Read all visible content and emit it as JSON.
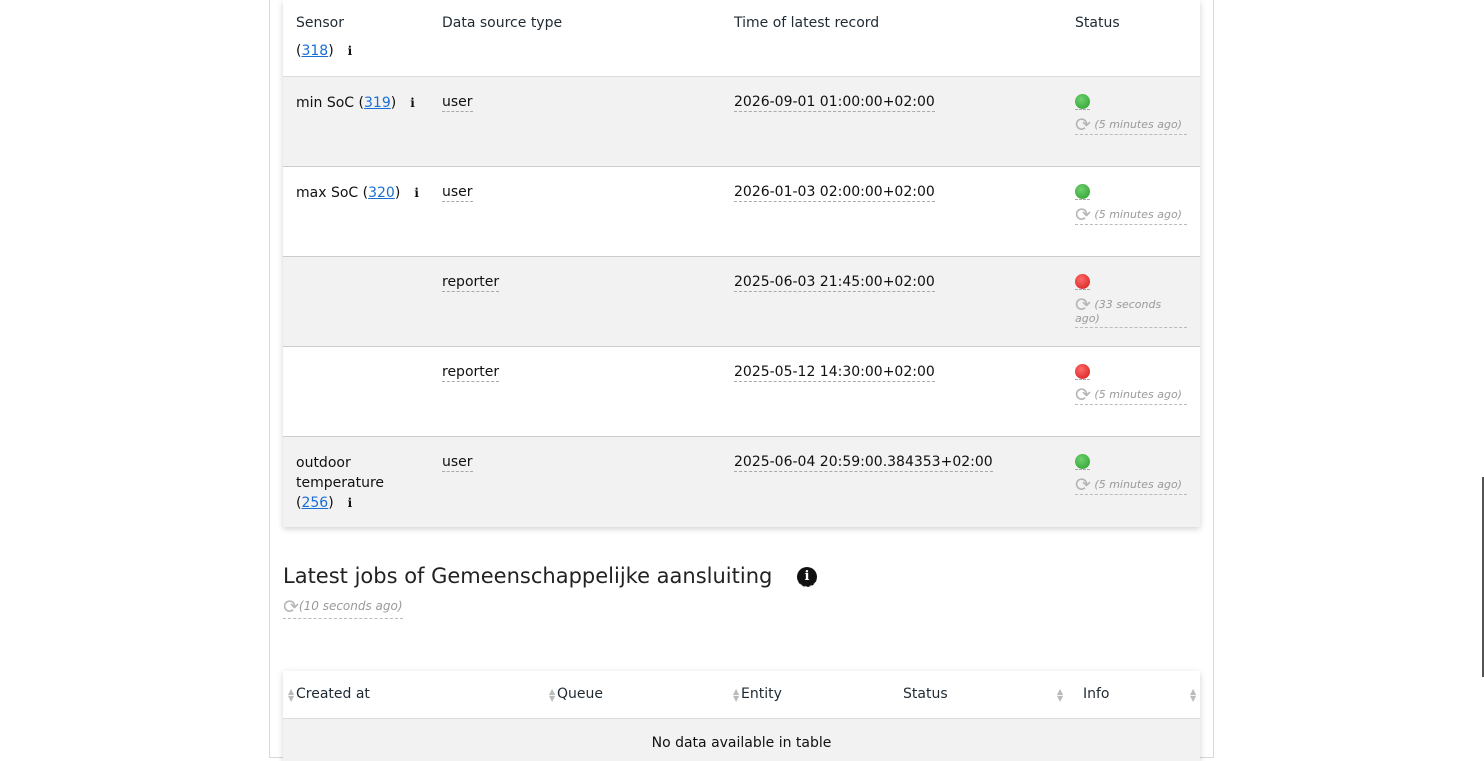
{
  "sensors_table": {
    "headers": [
      "Sensor",
      "Data source type",
      "Time of latest record",
      "Status"
    ],
    "partial_row": {
      "sensor_id": "318"
    },
    "rows": [
      {
        "sensor_name": "min SoC",
        "sensor_id": "319",
        "source_type": "user",
        "latest": "2026-09-01 01:00:00+02:00",
        "status": "green",
        "refreshed": "(5 minutes ago)"
      },
      {
        "sensor_name": "max SoC",
        "sensor_id": "320",
        "source_type": "user",
        "latest": "2026-01-03 02:00:00+02:00",
        "status": "green",
        "refreshed": "(5 minutes ago)"
      },
      {
        "sensor_name": "",
        "sensor_id": "",
        "source_type": "reporter",
        "latest": "2025-06-03 21:45:00+02:00",
        "status": "red",
        "refreshed": "(33 seconds ago)"
      },
      {
        "sensor_name": "",
        "sensor_id": "",
        "source_type": "reporter",
        "latest": "2025-05-12 14:30:00+02:00",
        "status": "red",
        "refreshed": "(5 minutes ago)"
      },
      {
        "sensor_name": "outdoor temperature",
        "sensor_id": "256",
        "source_type": "user",
        "latest": "2025-06-04 20:59:00.384353+02:00",
        "status": "green",
        "refreshed": "(5 minutes ago)"
      }
    ]
  },
  "jobs_section": {
    "title": "Latest jobs of Gemeenschappelijke aansluiting",
    "refreshed": "(10 seconds ago)",
    "headers": [
      "Created at",
      "Queue",
      "Entity",
      "Status",
      "Info"
    ],
    "empty_message": "No data available in table"
  },
  "colors": {
    "link": "#1a6fd4",
    "status_green": "#2b9d2b",
    "status_red": "#d21919"
  }
}
